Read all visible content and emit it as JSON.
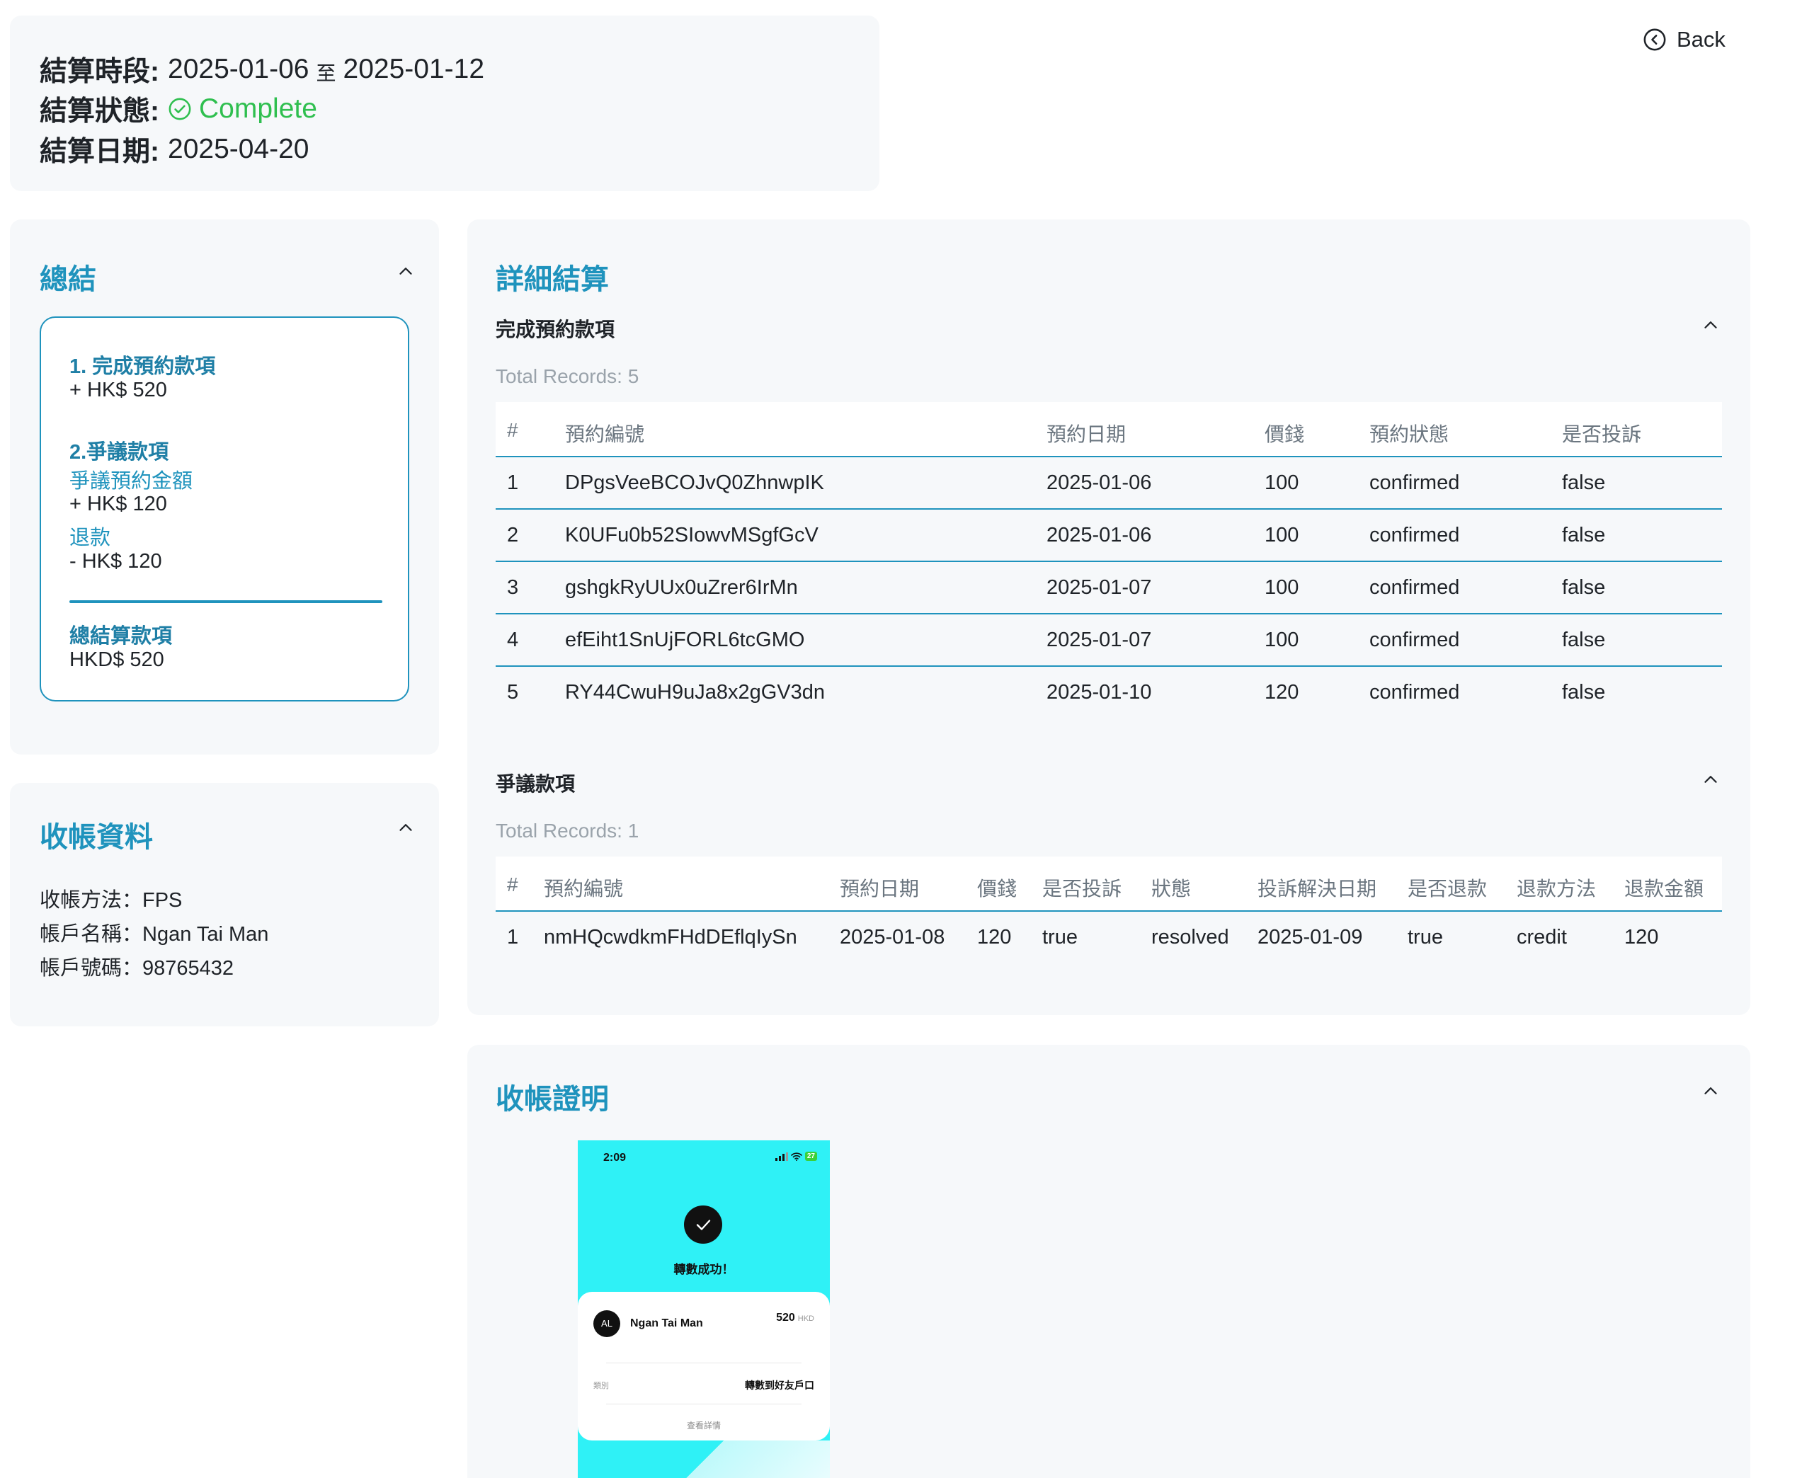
{
  "header": {
    "period_label": "結算時段:",
    "period_start": "2025-01-06",
    "period_to": "至",
    "period_end": "2025-01-12",
    "status_label": "結算狀態:",
    "status_value": "Complete",
    "status_color": "#2fbf4f",
    "date_label": "結算日期:",
    "date_value": "2025-04-20"
  },
  "back_label": "Back",
  "summary": {
    "title": "總結",
    "completed_heading": "1. 完成預約款項",
    "completed_amount": "+ HK$ 520",
    "dispute_heading": "2.爭議款項",
    "dispute_amount_label": "爭議預約金額",
    "dispute_amount": "+ HK$ 120",
    "refund_label": "退款",
    "refund_amount": "- HK$ 120",
    "total_label": "總結算款項",
    "total_amount": "HKD$ 520"
  },
  "payee": {
    "title": "收帳資料",
    "method": "收帳方法：FPS",
    "account_name": "帳戶名稱：Ngan Tai Man",
    "account_number": "帳戶號碼：98765432"
  },
  "details": {
    "title": "詳細結算",
    "completed": {
      "title": "完成預約款項",
      "records": "Total Records: 5",
      "headers": [
        "#",
        "預約編號",
        "預約日期",
        "價錢",
        "預約狀態",
        "是否投訴"
      ],
      "rows": [
        [
          "1",
          "DPgsVeeBCOJvQ0ZhnwpIK",
          "2025-01-06",
          "100",
          "confirmed",
          "false"
        ],
        [
          "2",
          "K0UFu0b52SIowvMSgfGcV",
          "2025-01-06",
          "100",
          "confirmed",
          "false"
        ],
        [
          "3",
          "gshgkRyUUx0uZrer6IrMn",
          "2025-01-07",
          "100",
          "confirmed",
          "false"
        ],
        [
          "4",
          "efEiht1SnUjFORL6tcGMO",
          "2025-01-07",
          "100",
          "confirmed",
          "false"
        ],
        [
          "5",
          "RY44CwuH9uJa8x2gGV3dn",
          "2025-01-10",
          "120",
          "confirmed",
          "false"
        ]
      ]
    },
    "disputes": {
      "title": "爭議款項",
      "records": "Total Records: 1",
      "headers": [
        "#",
        "預約編號",
        "預約日期",
        "價錢",
        "是否投訴",
        "狀態",
        "投訴解決日期",
        "是否退款",
        "退款方法",
        "退款金額"
      ],
      "rows": [
        [
          "1",
          "nmHQcwdkmFHdDEflqIySn",
          "2025-01-08",
          "120",
          "true",
          "resolved",
          "2025-01-09",
          "true",
          "credit",
          "120"
        ]
      ]
    }
  },
  "proof": {
    "title": "收帳證明",
    "image": {
      "time": "2:09",
      "battery": "27",
      "success_text": "轉數成功！",
      "avatar": "AL",
      "name": "Ngan Tai Man",
      "amount": "520",
      "currency": "HKD",
      "type_label": "類別",
      "type_value": "轉數到好友戶口",
      "more": "查看詳情"
    }
  }
}
